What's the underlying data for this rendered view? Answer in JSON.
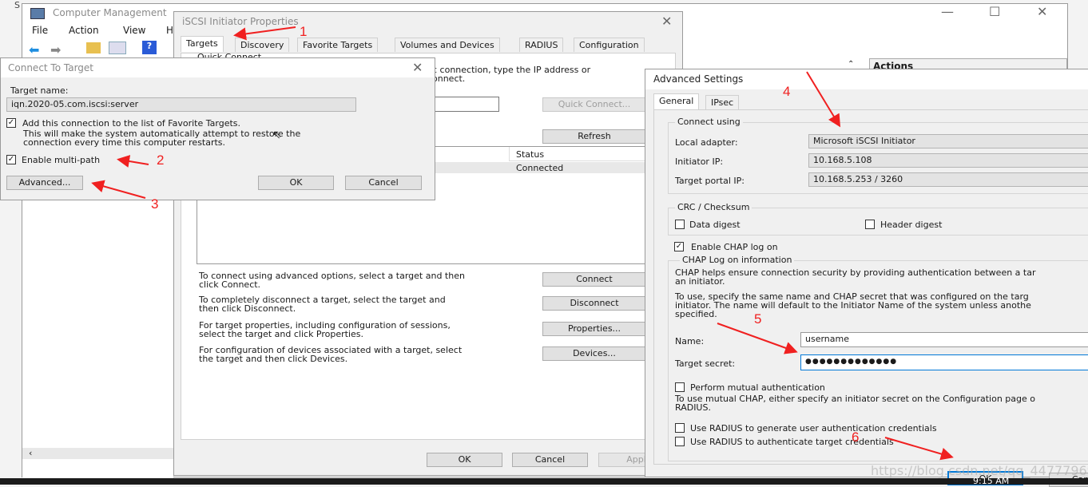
{
  "desktop": {
    "corner_text": "S",
    "taskbar_time": "9:15 AM",
    "watermark": "https://blog.csdn.net/qq_44777969"
  },
  "computer_management": {
    "title": "Computer Management",
    "menu": [
      "File",
      "Action",
      "View",
      "H"
    ],
    "actions_header": "Actions"
  },
  "iscsi": {
    "title": "iSCSI Initiator Properties",
    "tabs": [
      "Targets",
      "Discovery",
      "Favorite Targets",
      "Volumes and Devices",
      "RADIUS",
      "Configuration"
    ],
    "quick_connect_group": "Quick Connect",
    "quick_connect_text_1": "c connection, type the IP address or",
    "quick_connect_text_2": "onnect.",
    "quick_connect_button": "Quick Connect...",
    "refresh_button": "Refresh",
    "list_header_status": "Status",
    "list_row_status": "Connected",
    "actions": [
      {
        "text1": "To connect using advanced options, select a target and then",
        "text2": "click Connect.",
        "button": "Connect"
      },
      {
        "text1": "To completely disconnect a target, select the target and",
        "text2": "then click Disconnect.",
        "button": "Disconnect"
      },
      {
        "text1": "For target properties, including configuration of sessions,",
        "text2": "select the target and click Properties.",
        "button": "Properties..."
      },
      {
        "text1": "For configuration of devices associated with a target, select",
        "text2": "the target and then click Devices.",
        "button": "Devices..."
      }
    ],
    "ok": "OK",
    "cancel": "Cancel",
    "apply": "Appl"
  },
  "connect_to_target": {
    "title": "Connect To Target",
    "target_name_label": "Target name:",
    "target_name_value": "iqn.2020-05.com.iscsi:server",
    "favorite_checkbox": {
      "label": "Add this connection to the list of Favorite Targets.",
      "checked": true
    },
    "favorite_desc_1": "This will make the system automatically attempt to restore the",
    "favorite_desc_2": "connection every time this computer restarts.",
    "multipath_checkbox": {
      "label": "Enable multi-path",
      "checked": true
    },
    "advanced_button": "Advanced...",
    "ok": "OK",
    "cancel": "Cancel"
  },
  "advanced_settings": {
    "title": "Advanced Settings",
    "tabs": [
      "General",
      "IPsec"
    ],
    "connect_using": "Connect using",
    "local_adapter_label": "Local adapter:",
    "local_adapter_value": "Microsoft iSCSI Initiator",
    "initiator_ip_label": "Initiator IP:",
    "initiator_ip_value": "10.168.5.108",
    "target_portal_label": "Target portal IP:",
    "target_portal_value": "10.168.5.253 / 3260",
    "crc_group": "CRC / Checksum",
    "data_digest": {
      "label": "Data digest",
      "checked": false
    },
    "header_digest": {
      "label": "Header digest",
      "checked": false
    },
    "enable_chap": {
      "label": "Enable CHAP log on",
      "checked": true
    },
    "chap_group": "CHAP Log on information",
    "chap_text_1": "CHAP helps ensure connection security by providing authentication between a tar",
    "chap_text_2": "an initiator.",
    "chap_text_3": "To use, specify the same name and CHAP secret that was configured on the targ",
    "chap_text_4": "initiator.  The name will default to the Initiator Name of the system unless anothe",
    "chap_text_5": "specified.",
    "name_label": "Name:",
    "name_value": "username",
    "secret_label": "Target secret:",
    "secret_value": "●●●●●●●●●●●●●",
    "mutual_auth": {
      "label": "Perform mutual authentication",
      "checked": false
    },
    "mutual_text_1": "To use mutual CHAP, either specify an initiator secret on the Configuration page o",
    "mutual_text_2": "RADIUS.",
    "radius_generate": {
      "label": "Use RADIUS to generate user authentication credentials",
      "checked": false
    },
    "radius_authenticate": {
      "label": "Use RADIUS to authenticate target credentials",
      "checked": false
    },
    "ok": "OK",
    "cancel": "Cancel"
  },
  "annotations": [
    "1",
    "2",
    "3",
    "4",
    "5",
    "6"
  ],
  "colors": {
    "annotation": "#f02020",
    "focus": "#0078d7"
  }
}
